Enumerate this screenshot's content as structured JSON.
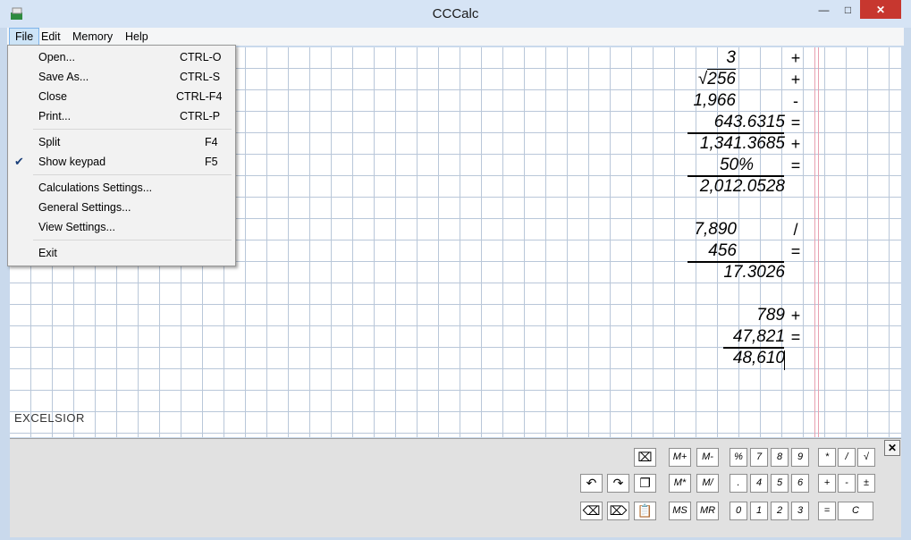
{
  "window": {
    "title": "CCCalc",
    "min_label": "—",
    "max_label": "□",
    "close_label": "✕"
  },
  "menubar": {
    "file": "File",
    "edit": "Edit",
    "memory": "Memory",
    "help": "Help"
  },
  "file_menu": [
    {
      "label": "Open...",
      "shortcut": "CTRL-O"
    },
    {
      "label": "Save As...",
      "shortcut": "CTRL-S"
    },
    {
      "label": "Close",
      "shortcut": "CTRL-F4"
    },
    {
      "label": "Print...",
      "shortcut": "CTRL-P"
    },
    {
      "label": "Split",
      "shortcut": "F4"
    },
    {
      "label": "Show keypad",
      "shortcut": "F5",
      "checked": true
    },
    {
      "label": "Calculations Settings...",
      "shortcut": ""
    },
    {
      "label": "General Settings...",
      "shortcut": ""
    },
    {
      "label": "View Settings...",
      "shortcut": ""
    },
    {
      "label": "Exit",
      "shortcut": ""
    }
  ],
  "calc": {
    "block1": [
      {
        "value": "3",
        "op": "+"
      },
      {
        "value": "256",
        "sqrt": "√",
        "op": "+"
      },
      {
        "value": "1,966",
        "op": "-"
      },
      {
        "value": "643.6315",
        "op": "="
      },
      {
        "value": "1,341.3685",
        "op": "+"
      },
      {
        "value": "50%",
        "op": "="
      },
      {
        "value": "2,012.0528",
        "op": ""
      }
    ],
    "block2": [
      {
        "value": "7,890",
        "op": "/"
      },
      {
        "value": "456",
        "op": "="
      },
      {
        "value": "17.3026",
        "op": ""
      }
    ],
    "block3": [
      {
        "value": "789",
        "op": "+"
      },
      {
        "value": "47,821",
        "op": "="
      },
      {
        "value": "48,610",
        "op": ""
      }
    ]
  },
  "logo": {
    "text": "EXCELSIOR"
  },
  "keypad": {
    "close": "✕",
    "memory": [
      "M+",
      "M-",
      "M*",
      "M/",
      "MS",
      "MR"
    ],
    "digits_row1": [
      "%",
      "7",
      "8",
      "9"
    ],
    "digits_row2": [
      ".",
      "4",
      "5",
      "6"
    ],
    "digits_row3": [
      "0",
      "1",
      "2",
      "3"
    ],
    "ops_row1": [
      "*",
      "/",
      "√"
    ],
    "ops_row2": [
      "+",
      "-",
      "±"
    ],
    "equals": "=",
    "clear": "C",
    "icons": {
      "clear_all": "⌧",
      "undo": "↶",
      "redo": "↷",
      "copy": "❐",
      "backspace": "⌫",
      "delete": "⌦",
      "paste": "📋"
    }
  }
}
